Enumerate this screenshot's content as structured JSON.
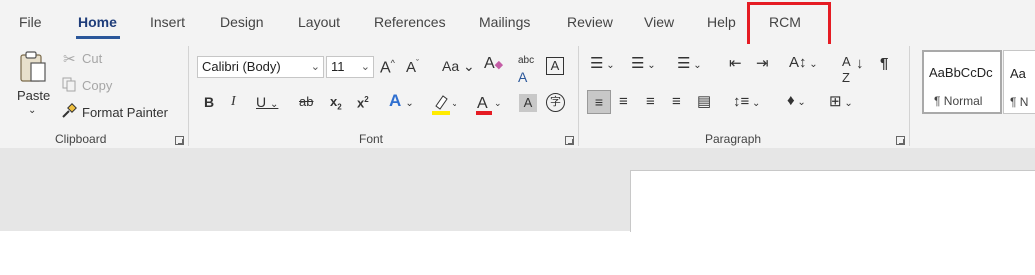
{
  "tabs": [
    "File",
    "Home",
    "Insert",
    "Design",
    "Layout",
    "References",
    "Mailings",
    "Review",
    "View",
    "Help",
    "RCM"
  ],
  "clipboard": {
    "paste": "Paste",
    "cut": "Cut",
    "copy": "Copy",
    "format_painter": "Format Painter",
    "group_label": "Clipboard"
  },
  "font": {
    "family": "Calibri (Body)",
    "size": "11",
    "change_case": "Aa",
    "group_label": "Font",
    "icons": [
      "grow-font-icon",
      "shrink-font-icon",
      "change-case-icon",
      "clear-formatting-icon",
      "phonetic-guide-icon",
      "character-border-icon",
      "bold-icon",
      "italic-icon",
      "underline-icon",
      "strikethrough-icon",
      "subscript-icon",
      "superscript-icon",
      "text-effects-icon",
      "highlight-color-icon",
      "font-color-icon",
      "character-shading-icon",
      "enclose-characters-icon"
    ]
  },
  "paragraph": {
    "group_label": "Paragraph",
    "icons": [
      "bullets-icon",
      "numbering-icon",
      "multilevel-list-icon",
      "decrease-indent-icon",
      "increase-indent-icon",
      "text-direction-icon",
      "sort-icon",
      "show-formatting-marks-icon",
      "align-left-icon",
      "center-icon",
      "align-right-icon",
      "justify-icon",
      "distributed-icon",
      "line-spacing-icon",
      "shading-icon",
      "borders-icon"
    ]
  },
  "styles": {
    "preview": "AaBbCcDc",
    "preview_cut": "Aa",
    "normal": "¶ Normal",
    "normal_cut": "¶ N"
  },
  "colors": {
    "accent": "#2b579a",
    "highlight_box": "#e51b23",
    "highlighter_yellow": "#ffeb00",
    "font_color_red": "#e51b23",
    "text_effects_blue": "#2f6fd0"
  }
}
